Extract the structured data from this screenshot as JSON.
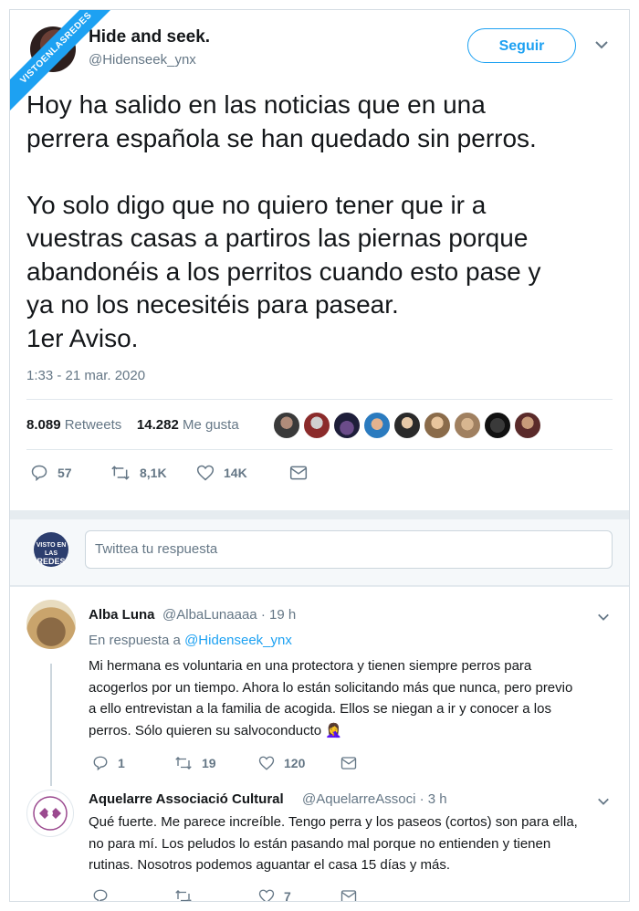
{
  "watermark": "VISTOENLASREDES",
  "tweet": {
    "author_name": "Hide and seek.",
    "author_handle": "@Hidenseek_ynx",
    "follow_label": "Seguir",
    "text": "Hoy ha salido en las noticias que en una\nperrera española se han quedado sin perros.\n\nYo solo digo que no quiero tener que ir a\nvuestras casas a partiros las piernas porque\nabandonéis a los perritos cuando esto pase y\nya no los necesitéis para pasear.\n1er Aviso.",
    "timestamp": "1:33 - 21 mar. 2020",
    "retweets_count": "8.089",
    "retweets_label": "Retweets",
    "likes_count": "14.282",
    "likes_label": "Me gusta",
    "actions": {
      "replies": "57",
      "retweets": "8,1K",
      "likes": "14K"
    }
  },
  "reply_box": {
    "placeholder": "Twittea tu respuesta",
    "avatar_text": [
      "VISTO EN LAS",
      "REDES"
    ]
  },
  "replies": [
    {
      "name": "Alba Luna",
      "handle": "@AlbaLunaaaa · 19 h",
      "in_reply_prefix": "En respuesta a",
      "in_reply_handle": "@Hidenseek_ynx",
      "text": "Mi hermana es voluntaria en una protectora y tienen siempre perros para\nacogerlos por un tiempo. Ahora lo están solicitando más que nunca, pero previo\na ello entrevistan a la familia de acogida. Ellos se niegan a ir y conocer a los\nperros. Sólo quieren su salvoconducto 🤦‍♀️",
      "replies": "1",
      "retweets": "19",
      "likes": "120"
    },
    {
      "name": "Aquelarre Associació Cultural",
      "handle": "@AquelarreAssoci · 3 h",
      "text": "Qué fuerte. Me parece increíble. Tengo perra y los paseos (cortos) son para ella,\nno para mí. Los peludos lo están pasando mal porque no entienden y tienen\nrutinas. Nosotros podemos aguantar el casa 15 días y más.",
      "replies": "",
      "retweets": "",
      "likes": "7"
    }
  ],
  "colors": {
    "accent": "#1da1f2",
    "secondary_text": "#657786",
    "background": "#e6ecf0"
  }
}
